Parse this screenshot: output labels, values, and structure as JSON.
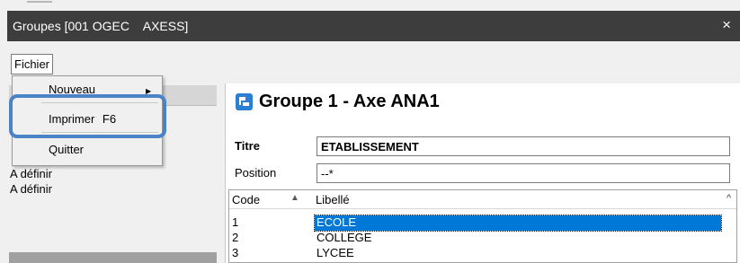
{
  "window": {
    "title": "Groupes [001 OGEC    AXESS]",
    "close_label": "×"
  },
  "menubar": {
    "fichier_label": "Fichier"
  },
  "file_menu": {
    "items": [
      {
        "label": "Nouveau",
        "shortcut": ""
      },
      {
        "label": "Imprimer",
        "shortcut": "F6"
      },
      {
        "label": "Quitter",
        "shortcut": ""
      }
    ]
  },
  "left_panel": {
    "items": [
      "A définir",
      "A définir"
    ]
  },
  "group": {
    "title": "Groupe 1 - Axe ANA1",
    "titre_label": "Titre",
    "titre_value": "ETABLISSEMENT",
    "position_label": "Position",
    "position_value": "--*"
  },
  "grid": {
    "columns": [
      "Code",
      "Libellé"
    ],
    "rows": [
      {
        "code": "1",
        "libelle": "ECOLE",
        "selected": true
      },
      {
        "code": "2",
        "libelle": "COLLEGE",
        "selected": false
      },
      {
        "code": "3",
        "libelle": "LYCEE",
        "selected": false
      }
    ]
  },
  "colors": {
    "titlebar_bg": "#3d3d3d",
    "selection": "#0078d7",
    "highlight_ring": "#4a84c6",
    "group_icon": "#2c7fd1"
  },
  "icons": {
    "group_icon": "group-icon",
    "close_icon": "close-icon",
    "sort_icon": "sort-asc-icon",
    "scroll_icon": "scroll-up-icon",
    "submenu_icon": "submenu-arrow-icon"
  }
}
